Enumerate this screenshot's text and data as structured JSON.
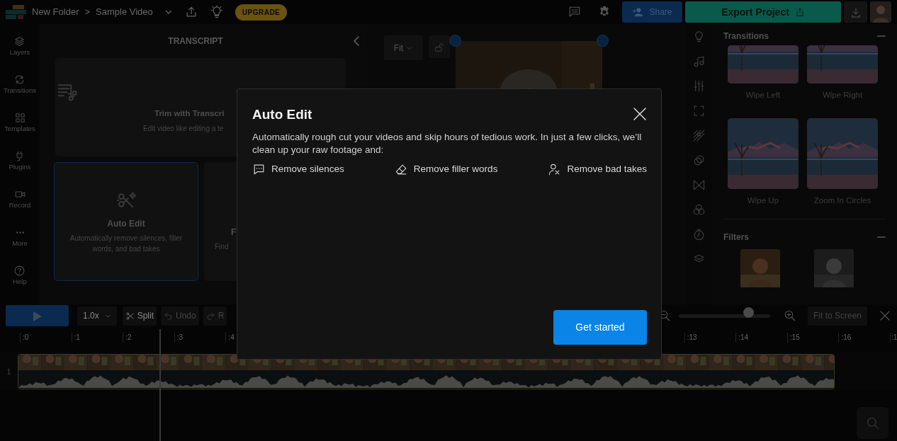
{
  "topbar": {
    "breadcrumb": [
      {
        "label": "New Folder"
      },
      {
        "label": "Sample Video"
      }
    ],
    "separator": ">",
    "upgrade": "UPGRADE",
    "share": "Share",
    "export": "Export Project"
  },
  "sidebar": {
    "items": [
      {
        "label": "Layers"
      },
      {
        "label": "Transitions"
      },
      {
        "label": "Templates"
      },
      {
        "label": "Plugins"
      },
      {
        "label": "Record"
      },
      {
        "label": "More"
      },
      {
        "label": "Help"
      }
    ]
  },
  "transcript": {
    "title": "TRANSCRIPT",
    "cards": [
      {
        "kind": "wide",
        "title": "Trim with Transcri",
        "description": "Edit video like editing a te",
        "selected": false
      },
      {
        "kind": "tile",
        "title": "Auto Edit",
        "description": "Automatically remove silences, filler words, and bad takes",
        "selected": true
      },
      {
        "kind": "tile",
        "title": "F",
        "description": "Find",
        "selected": false
      }
    ]
  },
  "preview": {
    "fit": "Fit"
  },
  "transitions": {
    "title": "Transitions",
    "items": [
      {
        "label": "Wipe Left"
      },
      {
        "label": "Wipe Right"
      },
      {
        "label": "Wipe Up"
      },
      {
        "label": "Zoom In Circles"
      }
    ]
  },
  "filters": {
    "title": "Filters"
  },
  "timeline": {
    "speed": "1.0x",
    "tools": [
      {
        "label": "Split",
        "disabled": false
      },
      {
        "label": "Undo",
        "disabled": true
      },
      {
        "label": "R",
        "disabled": true
      }
    ],
    "zoom": {
      "level": 0.75
    },
    "fit": "Fit to Screen",
    "ruler_start": [
      ":0",
      ":1",
      ":2",
      ":3",
      ":4"
    ],
    "ruler_end": [
      ":13",
      ":14",
      ":15",
      ":16",
      ":1"
    ],
    "track": "1"
  },
  "modal": {
    "title": "Auto Edit",
    "description": "Automatically rough cut your videos and skip hours of tedious work. In just a few clicks, we’ll clean up your raw footage and:",
    "features": [
      {
        "label": "Remove silences"
      },
      {
        "label": "Remove filler words"
      },
      {
        "label": "Remove bad takes"
      }
    ],
    "button": "Get started"
  }
}
